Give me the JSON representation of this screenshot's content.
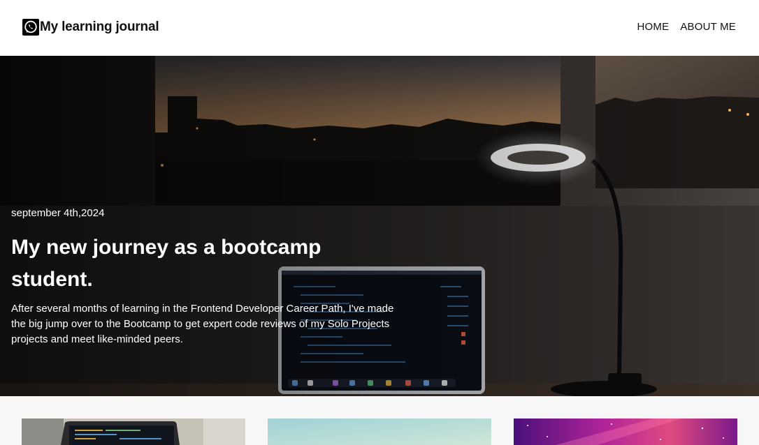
{
  "header": {
    "logo_icon": "whatsapp-logo-icon",
    "title": "My learning journal",
    "nav": [
      {
        "label": "HOME"
      },
      {
        "label": "ABOUT ME"
      }
    ]
  },
  "hero": {
    "date": "september 4th,2024",
    "title": "My new journey as a bootcamp student.",
    "description": "After several months of learning in the Frontend Developer Career Path, I've made the big jump over to the Bootcamp to get expert code reviews of my Solo Projects projects and meet like-minded peers."
  },
  "cards": [
    {
      "image": "laptop-code-thumbnail"
    },
    {
      "image": "sky-gradient-thumbnail"
    },
    {
      "image": "purple-space-thumbnail"
    }
  ]
}
